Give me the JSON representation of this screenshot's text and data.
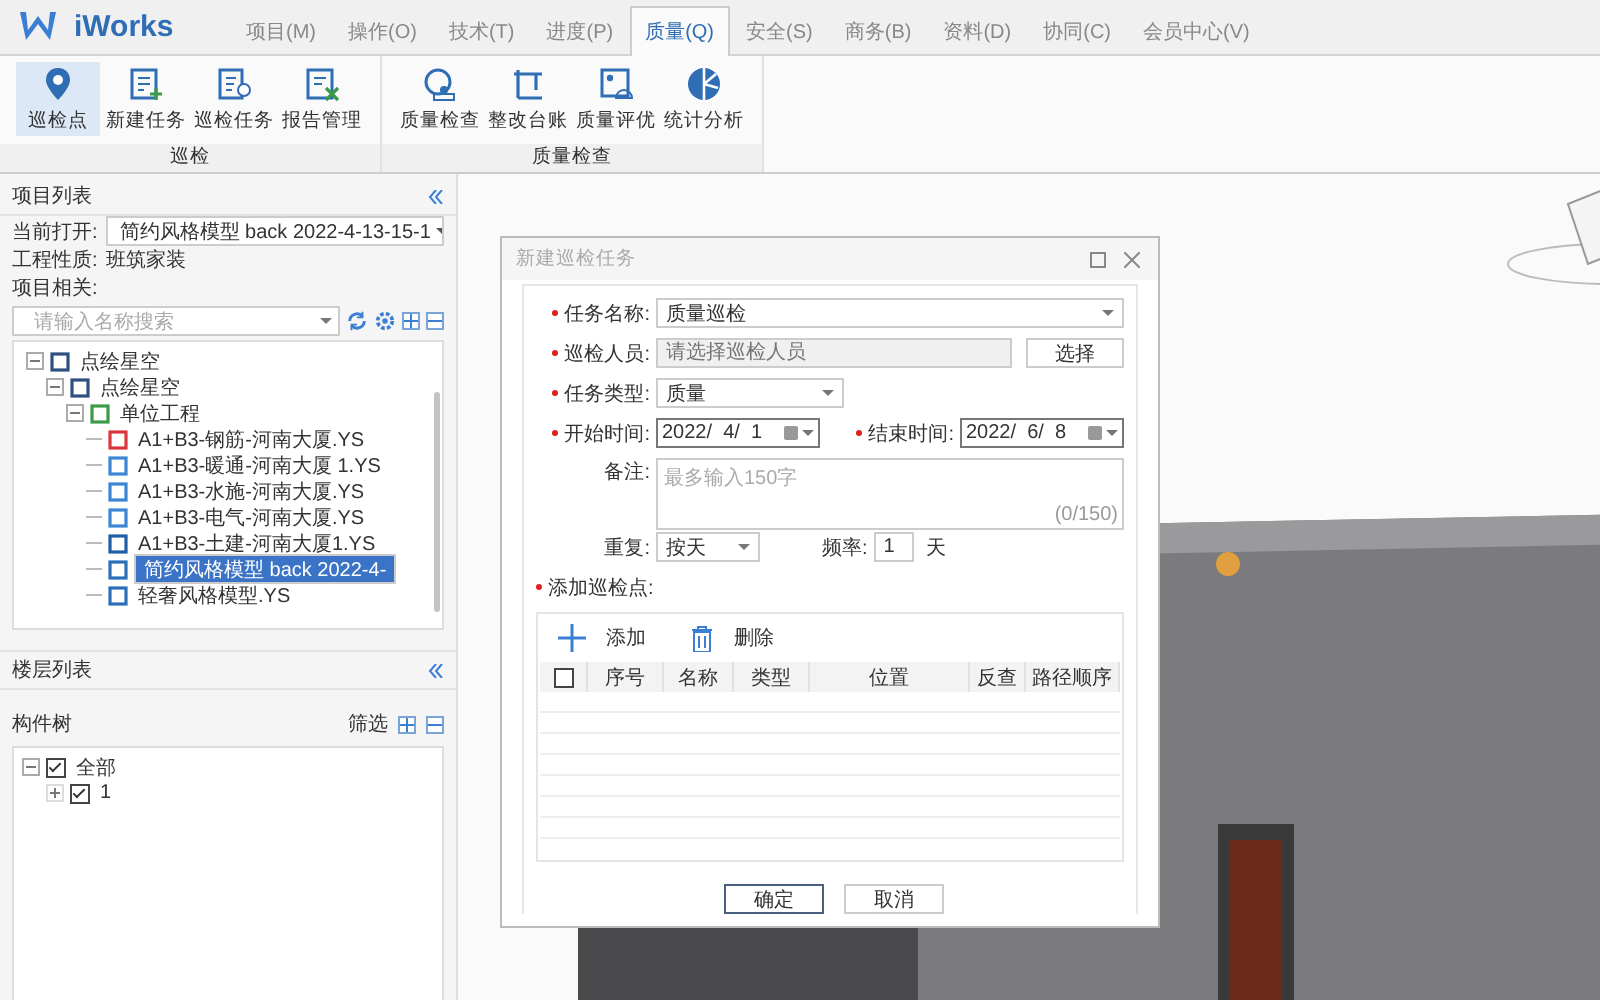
{
  "app": {
    "name": "iWorks"
  },
  "menu_tabs": [
    {
      "label": "项目(M)",
      "selected": false
    },
    {
      "label": "操作(O)",
      "selected": false
    },
    {
      "label": "技术(T)",
      "selected": false
    },
    {
      "label": "进度(P)",
      "selected": false
    },
    {
      "label": "质量(Q)",
      "selected": true
    },
    {
      "label": "安全(S)",
      "selected": false
    },
    {
      "label": "商务(B)",
      "selected": false
    },
    {
      "label": "资料(D)",
      "selected": false
    },
    {
      "label": "协同(C)",
      "selected": false
    },
    {
      "label": "会员中心(V)",
      "selected": false
    }
  ],
  "ribbon_groups": [
    {
      "title": "巡检",
      "buttons": [
        {
          "label": "巡检点",
          "kind": "pin",
          "selected": true
        },
        {
          "label": "新建任务",
          "kind": "new",
          "selected": false
        },
        {
          "label": "巡检任务",
          "kind": "tasks",
          "selected": false
        },
        {
          "label": "报告管理",
          "kind": "report",
          "selected": false
        }
      ]
    },
    {
      "title": "质量检查",
      "buttons": [
        {
          "label": "质量检查",
          "kind": "inspect",
          "selected": false
        },
        {
          "label": "整改台账",
          "kind": "ledger",
          "selected": false
        },
        {
          "label": "质量评优",
          "kind": "award",
          "selected": false
        },
        {
          "label": "统计分析",
          "kind": "pie",
          "selected": false
        }
      ]
    }
  ],
  "project_list": {
    "title": "项目列表",
    "current_label": "当前打开:",
    "current_value": "简约风格模型 back 2022-4-13-15-1",
    "nature_label": "工程性质:",
    "nature_value": "班筑家装",
    "related_label": "项目相关:",
    "search_placeholder": "请输入名称搜索",
    "tree": [
      {
        "label": "点绘星空",
        "kind": "building",
        "expanded": true,
        "selected": false,
        "children": [
          {
            "label": "点绘星空",
            "kind": "list",
            "expanded": true,
            "selected": false,
            "children": [
              {
                "label": "单位工程",
                "kind": "unit",
                "expanded": true,
                "selected": false,
                "children": [
                  {
                    "label": "A1+B3-钢筋-河南大厦.YS",
                    "kind": "rebar",
                    "selected": false
                  },
                  {
                    "label": "A1+B3-暖通-河南大厦 1.YS",
                    "kind": "pipe",
                    "selected": false
                  },
                  {
                    "label": "A1+B3-水施-河南大厦.YS",
                    "kind": "pipe",
                    "selected": false
                  },
                  {
                    "label": "A1+B3-电气-河南大厦.YS",
                    "kind": "pipe",
                    "selected": false
                  },
                  {
                    "label": "A1+B3-土建-河南大厦1.YS",
                    "kind": "civil",
                    "selected": false
                  },
                  {
                    "label": "简约风格模型 back 2022-4-",
                    "kind": "model",
                    "selected": true
                  },
                  {
                    "label": "轻奢风格模型.YS",
                    "kind": "model",
                    "selected": false
                  }
                ]
              }
            ]
          }
        ]
      }
    ]
  },
  "floor_list": {
    "title": "楼层列表",
    "tree_label": "构件树",
    "filter": "筛选",
    "tree": [
      {
        "label": "全部",
        "checked": true,
        "expanded": true,
        "children": [
          {
            "label": "1",
            "checked": true
          }
        ]
      }
    ]
  },
  "dialog": {
    "title": "新建巡检任务",
    "task_name": {
      "label": "任务名称:",
      "required": true,
      "value": "质量巡检"
    },
    "inspector": {
      "label": "巡检人员:",
      "required": true,
      "placeholder": "请选择巡检人员",
      "button": "选择"
    },
    "task_type": {
      "label": "任务类型:",
      "required": true,
      "value": "质量"
    },
    "start_time": {
      "label": "开始时间:",
      "required": true,
      "value": "2022/  4/  1"
    },
    "end_time": {
      "label": "结束时间:",
      "required": true,
      "value": "2022/  6/  8"
    },
    "remark": {
      "label": "备注:",
      "required": false,
      "placeholder": "最多输入150字",
      "counter": "(0/150)"
    },
    "repeat": {
      "label": "重复:",
      "value": "按天"
    },
    "frequency": {
      "label": "频率:",
      "value": "1",
      "unit": "天"
    },
    "points": {
      "label": "添加巡检点:",
      "required": true,
      "add": "添加",
      "delete": "删除",
      "header_checked": false,
      "columns": [
        "序号",
        "名称",
        "类型",
        "位置",
        "反查",
        "路径顺序"
      ]
    },
    "buttons": [
      {
        "label": "确定",
        "primary": true
      },
      {
        "label": "取消",
        "primary": false
      }
    ]
  }
}
